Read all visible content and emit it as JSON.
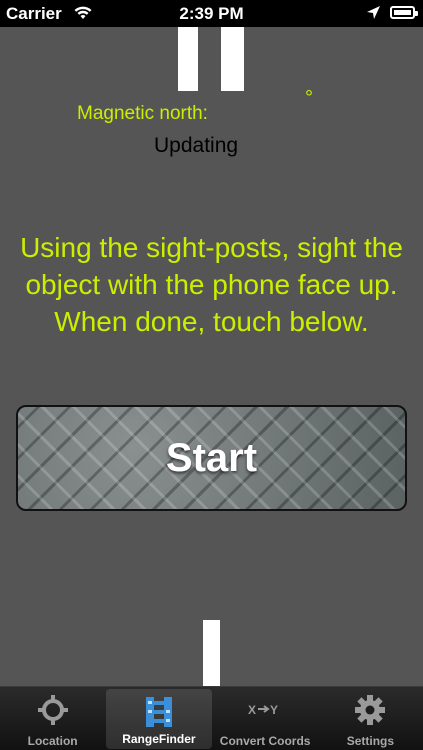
{
  "status_bar": {
    "carrier": "Carrier",
    "time": "2:39 PM",
    "wifi_icon": "wifi-icon",
    "location_icon": "location-arrow-icon",
    "battery_icon": "battery-icon"
  },
  "compass": {
    "label": "Magnetic north:",
    "degree_symbol": "°",
    "value": "Updating"
  },
  "instructions": "Using the sight-posts, sight the object with the phone face up. When done, touch below.",
  "start_button": {
    "label": "Start"
  },
  "tab_bar": {
    "active_tab": "RangeFinder",
    "tabs": [
      {
        "label": "Location",
        "icon": "crosshair-icon"
      },
      {
        "label": "RangeFinder",
        "icon": "rangefinder-icon"
      },
      {
        "label": "Convert Coords",
        "icon": "convert-xy-icon"
      },
      {
        "label": "Settings",
        "icon": "gear-icon"
      }
    ]
  },
  "colors": {
    "accent": "#ccee00",
    "background": "#555555",
    "active_icon": "#3a8fd8"
  }
}
